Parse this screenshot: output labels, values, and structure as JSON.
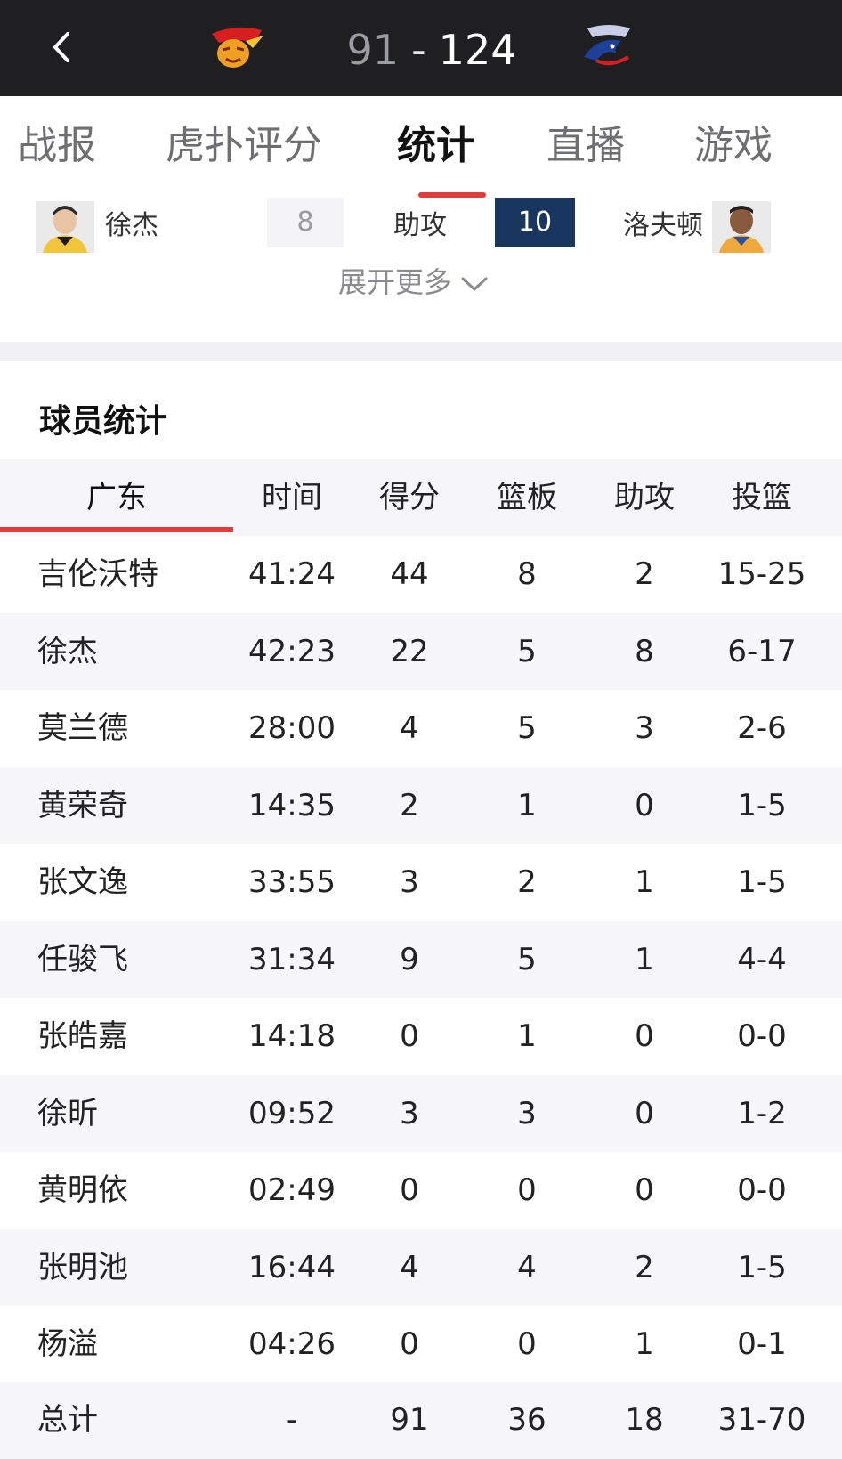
{
  "scoreboard": {
    "home_score": "91",
    "separator": "-",
    "away_score": "124",
    "home_logo_icon": "guangdong-tigers-logo-icon",
    "away_logo_icon": "shanghai-sharks-logo-icon"
  },
  "tabs": [
    {
      "label": "战报"
    },
    {
      "label": "虎扑评分"
    },
    {
      "label": "统计",
      "active": true
    },
    {
      "label": "直播"
    },
    {
      "label": "游戏"
    }
  ],
  "leader": {
    "home_name": "徐杰",
    "home_value": "8",
    "stat_label": "助攻",
    "away_value": "10",
    "away_name": "洛夫顿"
  },
  "expand_label": "展开更多",
  "player_stats": {
    "title": "球员统计",
    "team": "广东",
    "columns": [
      "时间",
      "得分",
      "篮板",
      "助攻",
      "投篮"
    ],
    "rows": [
      {
        "name": "吉伦沃特",
        "time": "41:24",
        "pts": "44",
        "reb": "8",
        "ast": "2",
        "fg": "15-25"
      },
      {
        "name": "徐杰",
        "time": "42:23",
        "pts": "22",
        "reb": "5",
        "ast": "8",
        "fg": "6-17"
      },
      {
        "name": "莫兰德",
        "time": "28:00",
        "pts": "4",
        "reb": "5",
        "ast": "3",
        "fg": "2-6"
      },
      {
        "name": "黄荣奇",
        "time": "14:35",
        "pts": "2",
        "reb": "1",
        "ast": "0",
        "fg": "1-5"
      },
      {
        "name": "张文逸",
        "time": "33:55",
        "pts": "3",
        "reb": "2",
        "ast": "1",
        "fg": "1-5"
      },
      {
        "name": "任骏飞",
        "time": "31:34",
        "pts": "9",
        "reb": "5",
        "ast": "1",
        "fg": "4-4"
      },
      {
        "name": "张皓嘉",
        "time": "14:18",
        "pts": "0",
        "reb": "1",
        "ast": "0",
        "fg": "0-0"
      },
      {
        "name": "徐昕",
        "time": "09:52",
        "pts": "3",
        "reb": "3",
        "ast": "0",
        "fg": "1-2"
      },
      {
        "name": "黄明依",
        "time": "02:49",
        "pts": "0",
        "reb": "0",
        "ast": "0",
        "fg": "0-0"
      },
      {
        "name": "张明池",
        "time": "16:44",
        "pts": "4",
        "reb": "4",
        "ast": "2",
        "fg": "1-5"
      },
      {
        "name": "杨溢",
        "time": "04:26",
        "pts": "0",
        "reb": "0",
        "ast": "1",
        "fg": "0-1"
      },
      {
        "name": "总计",
        "time": "-",
        "pts": "91",
        "reb": "36",
        "ast": "18",
        "fg": "31-70"
      }
    ]
  },
  "colors": {
    "topbar": "#1f1f22",
    "accent_red": "#e23b3b",
    "away_highlight": "#19375e"
  }
}
